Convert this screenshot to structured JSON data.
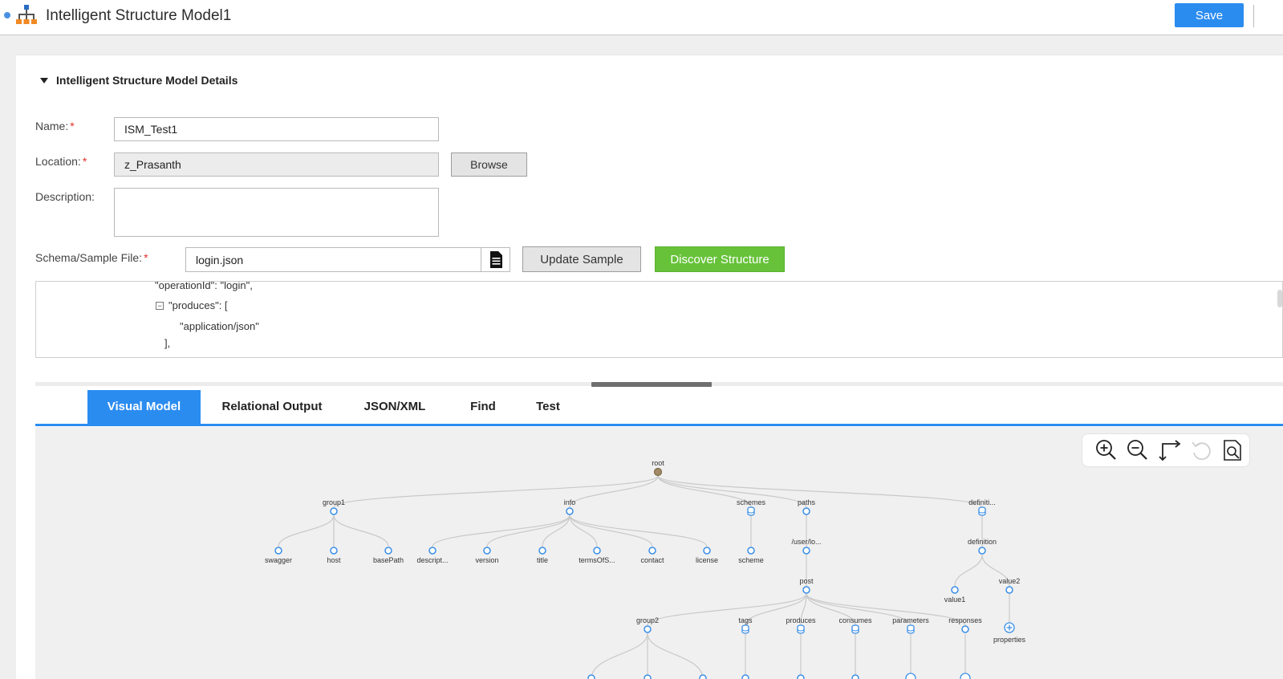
{
  "header": {
    "title": "Intelligent Structure Model1",
    "save_label": "Save"
  },
  "section": {
    "title": "Intelligent Structure Model Details"
  },
  "form": {
    "name_label": "Name:",
    "name_value": "ISM_Test1",
    "location_label": "Location:",
    "location_value": "z_Prasanth",
    "browse_label": "Browse",
    "description_label": "Description:",
    "description_value": "",
    "schema_label": "Schema/Sample File:",
    "schema_value": "login.json",
    "update_label": "Update Sample",
    "discover_label": "Discover Structure",
    "required_mark": "*"
  },
  "code": {
    "lines": [
      "\"operationId\": \"login\",",
      "\"produces\": [",
      "\"application/json\"",
      "],"
    ],
    "collapse_symbol": "−"
  },
  "tabs": [
    {
      "label": "Visual Model",
      "active": true
    },
    {
      "label": "Relational Output",
      "active": false
    },
    {
      "label": "JSON/XML",
      "active": false
    },
    {
      "label": "Find",
      "active": false
    },
    {
      "label": "Test",
      "active": false
    }
  ],
  "tree": {
    "labels": {
      "root": "root",
      "group1": "group1",
      "info": "info",
      "schemes": "schemes",
      "paths": "paths",
      "definitions": "definiti...",
      "swagger": "swagger",
      "host": "host",
      "basePath": "basePath",
      "description": "descript...",
      "version": "version",
      "title": "title",
      "terms": "termsOfS...",
      "contact": "contact",
      "license": "license",
      "scheme": "scheme",
      "userlogin": "/user/lo...",
      "definition": "definition",
      "value1": "value1",
      "value2": "value2",
      "post": "post",
      "properties": "properties",
      "group2": "group2",
      "tags": "tags",
      "produces": "produces",
      "consumes": "consumes",
      "parameters": "parameters",
      "responses": "responses"
    }
  },
  "colors": {
    "accent": "#2b8cf0",
    "green": "#67c23a",
    "node": "#3a8ee6",
    "root_node": "#a08b66"
  }
}
